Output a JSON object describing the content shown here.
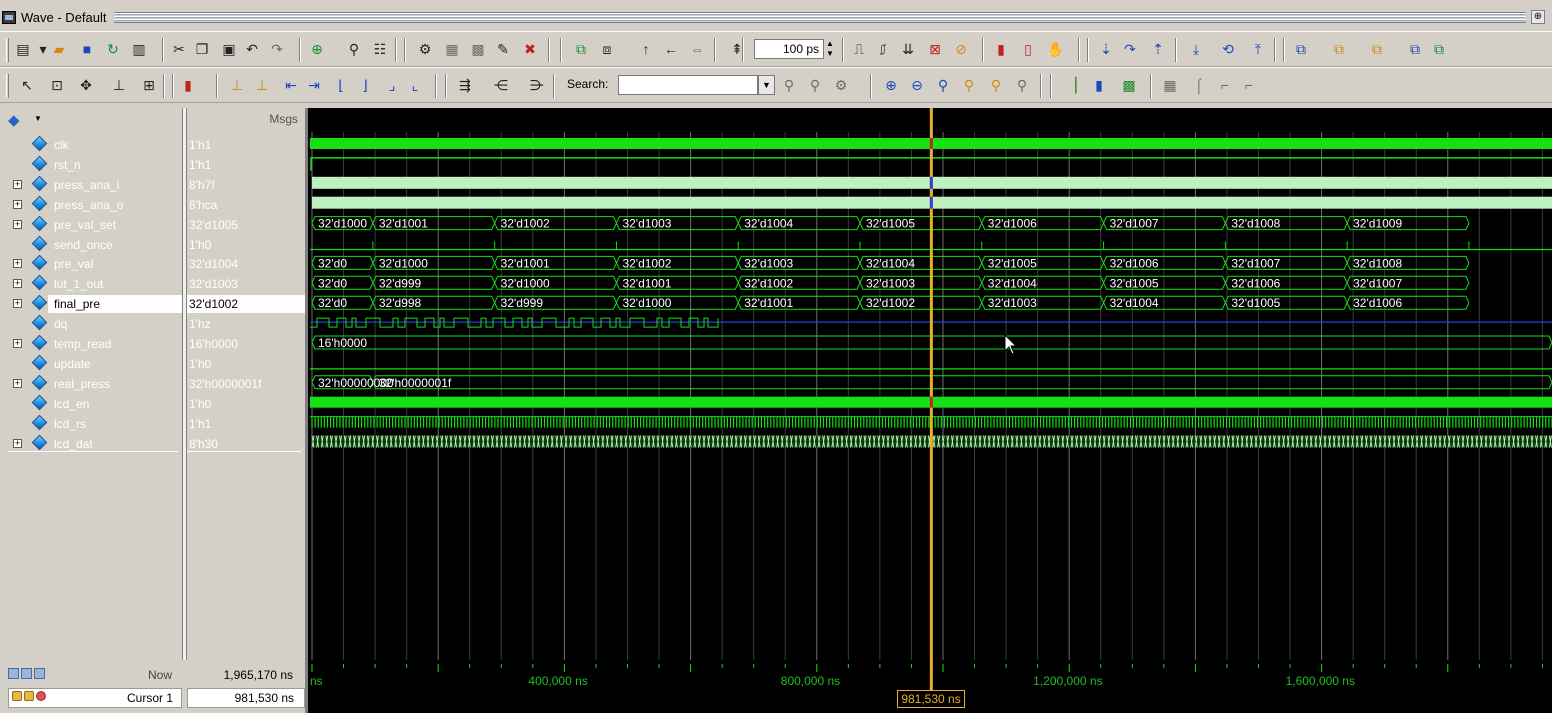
{
  "window": {
    "title": "Wave - Default",
    "restore_glyph": "⊕"
  },
  "toolbar1": {
    "buttons": [
      {
        "name": "print-icon",
        "glyph": "▤",
        "color": "#222"
      },
      {
        "name": "dropdown-icon",
        "glyph": "▾",
        "color": "#222"
      },
      {
        "name": "open-folder-icon",
        "glyph": "▰",
        "color": "#d08a10"
      },
      {
        "name": "save-icon",
        "glyph": "■",
        "color": "#1a46c0"
      },
      {
        "name": "reload-icon",
        "glyph": "↻",
        "color": "#1a8a2a"
      },
      {
        "name": "printer-icon",
        "glyph": "▥",
        "color": "#222"
      },
      {
        "name": "cut-icon",
        "glyph": "✂",
        "color": "#222"
      },
      {
        "name": "copy-icon",
        "glyph": "❐",
        "color": "#222"
      },
      {
        "name": "paste-icon",
        "glyph": "▣",
        "color": "#222"
      },
      {
        "name": "undo-icon",
        "glyph": "↶",
        "color": "#222"
      },
      {
        "name": "redo-icon",
        "glyph": "↷",
        "color": "#6a6a6a"
      },
      {
        "name": "add-icon",
        "glyph": "⊕",
        "color": "#1a8a2a"
      },
      {
        "name": "find-icon",
        "glyph": "⚲",
        "color": "#222"
      },
      {
        "name": "format-icon",
        "glyph": "☷",
        "color": "#222"
      },
      {
        "name": "compile-icon",
        "glyph": "⚙",
        "color": "#222"
      },
      {
        "name": "compile-all-icon",
        "glyph": "▦",
        "color": "#6a6a6a"
      },
      {
        "name": "simulate-icon",
        "glyph": "▩",
        "color": "#6a6a6a"
      },
      {
        "name": "break-icon",
        "glyph": "✎",
        "color": "#222"
      },
      {
        "name": "stop-icon",
        "glyph": "✖",
        "color": "#c0241a"
      },
      {
        "name": "zoom-region-icon",
        "glyph": "⧉",
        "color": "#1a8a2a"
      },
      {
        "name": "insert-icon",
        "glyph": "⧈",
        "color": "#222"
      },
      {
        "name": "up-arrow-icon",
        "glyph": "↑",
        "color": "#222"
      },
      {
        "name": "left-arrow-icon",
        "glyph": "←",
        "color": "#222"
      },
      {
        "name": "swap-icon",
        "glyph": "⇔",
        "color": "#6a6a6a"
      },
      {
        "name": "run-length-icon",
        "glyph": "⇞",
        "color": "#222"
      },
      {
        "name": "run-icon",
        "glyph": "⎍",
        "color": "#222"
      },
      {
        "name": "continue-icon",
        "glyph": "⎎",
        "color": "#222"
      },
      {
        "name": "run-all-icon",
        "glyph": "⇊",
        "color": "#222"
      },
      {
        "name": "break-sim-icon",
        "glyph": "⊠",
        "color": "#c0241a"
      },
      {
        "name": "stop-sim-icon",
        "glyph": "⊘",
        "color": "#d08a10"
      },
      {
        "name": "performance-icon",
        "glyph": "▮",
        "color": "#c0241a"
      },
      {
        "name": "memory-icon",
        "glyph": "▯",
        "color": "#c0241a"
      },
      {
        "name": "hand-icon",
        "glyph": "✋",
        "color": "#222"
      },
      {
        "name": "step-icon",
        "glyph": "⇣",
        "color": "#1a46c0"
      },
      {
        "name": "step-over-icon",
        "glyph": "↷",
        "color": "#1a46c0"
      },
      {
        "name": "step-out-icon",
        "glyph": "⇡",
        "color": "#1a46c0"
      },
      {
        "name": "step-into-icon",
        "glyph": "⤓",
        "color": "#1a46c0"
      },
      {
        "name": "step-back-icon",
        "glyph": "⟲",
        "color": "#1a46c0"
      },
      {
        "name": "step-up-icon",
        "glyph": "⤒",
        "color": "#1a46c0"
      },
      {
        "name": "layout-icon-1",
        "glyph": "⧉",
        "color": "#1a46c0"
      },
      {
        "name": "layout-icon-2",
        "glyph": "⧉",
        "color": "#d08a10"
      },
      {
        "name": "layout-icon-3",
        "glyph": "⧉",
        "color": "#d08a10"
      },
      {
        "name": "layout-icon-4",
        "glyph": "⧉",
        "color": "#1a46c0"
      },
      {
        "name": "layout-icon-5",
        "glyph": "⧉",
        "color": "#1a8a2a"
      }
    ],
    "run_length": "100 ps"
  },
  "toolbar2": {
    "buttons": [
      {
        "name": "select-icon",
        "glyph": "↖",
        "color": "#222"
      },
      {
        "name": "zoom-mode-icon",
        "glyph": "⊡",
        "color": "#222"
      },
      {
        "name": "pan-icon",
        "glyph": "✥",
        "color": "#222"
      },
      {
        "name": "insert-cursor-icon",
        "glyph": "⊥",
        "color": "#222"
      },
      {
        "name": "edit-mode-icon",
        "glyph": "⊞",
        "color": "#222"
      },
      {
        "name": "stop-light-icon",
        "glyph": "▮",
        "color": "#c0241a"
      },
      {
        "name": "edge-rise-icon",
        "glyph": "⊥",
        "color": "#d08a10"
      },
      {
        "name": "edge-fall-icon",
        "glyph": "⊥",
        "color": "#d08a10"
      },
      {
        "name": "edge-prev-icon",
        "glyph": "⇤",
        "color": "#1a46c0"
      },
      {
        "name": "edge-next-icon",
        "glyph": "⇥",
        "color": "#1a46c0"
      },
      {
        "name": "prev-transition-icon",
        "glyph": "⌊",
        "color": "#1a46c0"
      },
      {
        "name": "next-transition-icon",
        "glyph": "⌋",
        "color": "#1a46c0"
      },
      {
        "name": "falling-icon",
        "glyph": "⌟",
        "color": "#1a46c0"
      },
      {
        "name": "rising-icon",
        "glyph": "⌞",
        "color": "#1a46c0"
      },
      {
        "name": "expand-icon",
        "glyph": "⇶",
        "color": "#222"
      },
      {
        "name": "collapse-icon",
        "glyph": "⋲",
        "color": "#222"
      },
      {
        "name": "combine-icon",
        "glyph": "⋺",
        "color": "#222"
      },
      {
        "name": "search-find-icon",
        "glyph": "⚲",
        "color": "#6a6a6a"
      },
      {
        "name": "search-prev-icon",
        "glyph": "⚲",
        "color": "#6a6a6a"
      },
      {
        "name": "search-options-icon",
        "glyph": "⚙",
        "color": "#6a6a6a"
      },
      {
        "name": "zoom-in-icon",
        "glyph": "⊕",
        "color": "#1a46c0"
      },
      {
        "name": "zoom-out-icon",
        "glyph": "⊖",
        "color": "#1a46c0"
      },
      {
        "name": "zoom-full-icon",
        "glyph": "⚲",
        "color": "#1a46c0"
      },
      {
        "name": "zoom-cursor-icon",
        "glyph": "⚲",
        "color": "#d08a10"
      },
      {
        "name": "zoom-last-icon",
        "glyph": "⚲",
        "color": "#d08a10"
      },
      {
        "name": "zoom-region2-icon",
        "glyph": "⚲",
        "color": "#6a6a6a"
      },
      {
        "name": "wave-bar-icon",
        "glyph": "▕",
        "color": "#1a8a2a"
      },
      {
        "name": "wave-fill-icon",
        "glyph": "▮",
        "color": "#1a46c0"
      },
      {
        "name": "wave-dense-icon",
        "glyph": "▩",
        "color": "#1a8a2a"
      },
      {
        "name": "grid-icon",
        "glyph": "▦",
        "color": "#6a6a6a"
      },
      {
        "name": "signal-style1-icon",
        "glyph": "⌠",
        "color": "#6a6a6a"
      },
      {
        "name": "signal-style2-icon",
        "glyph": "⌐",
        "color": "#6a6a6a"
      },
      {
        "name": "signal-style3-icon",
        "glyph": "⌐",
        "color": "#6a6a6a"
      }
    ],
    "search_label": "Search:",
    "search_value": ""
  },
  "signals_header": {
    "msgs_label": "Msgs"
  },
  "signals": [
    {
      "name": "clk",
      "value": "1'h1",
      "expandable": false
    },
    {
      "name": "rst_n",
      "value": "1'h1",
      "expandable": false
    },
    {
      "name": "press_ana_i",
      "value": "8'h7f",
      "expandable": true
    },
    {
      "name": "press_ana_o",
      "value": "8'hca",
      "expandable": true
    },
    {
      "name": "pre_val_set",
      "value": "32'd1005",
      "expandable": true
    },
    {
      "name": "send_once",
      "value": "1'h0",
      "expandable": false
    },
    {
      "name": "pre_val",
      "value": "32'd1004",
      "expandable": true
    },
    {
      "name": "lut_1_out",
      "value": "32'd1003",
      "expandable": true
    },
    {
      "name": "final_pre",
      "value": "32'd1002",
      "expandable": true,
      "selected": true
    },
    {
      "name": "dq",
      "value": "1'hz",
      "expandable": false
    },
    {
      "name": "temp_read",
      "value": "16'h0000",
      "expandable": true
    },
    {
      "name": "update",
      "value": "1'h0",
      "expandable": false
    },
    {
      "name": "real_press",
      "value": "32'h0000001f",
      "expandable": true
    },
    {
      "name": "lcd_en",
      "value": "1'h0",
      "expandable": false
    },
    {
      "name": "lcd_rs",
      "value": "1'h1",
      "expandable": false
    },
    {
      "name": "lcd_dat",
      "value": "8'h30",
      "expandable": true
    }
  ],
  "waves": {
    "pre_val_set": [
      "32'd1000",
      "32'd1001",
      "32'd1002",
      "32'd1003",
      "32'd1004",
      "32'd1005",
      "32'd1006",
      "32'd1007",
      "32'd1008",
      "32'd1009"
    ],
    "pre_val": [
      "32'd0",
      "32'd1000",
      "32'd1001",
      "32'd1002",
      "32'd1003",
      "32'd1004",
      "32'd1005",
      "32'd1006",
      "32'd1007",
      "32'd1008"
    ],
    "lut_1_out": [
      "32'd0",
      "32'd999",
      "32'd1000",
      "32'd1001",
      "32'd1002",
      "32'd1003",
      "32'd1004",
      "32'd1005",
      "32'd1006",
      "32'd1007"
    ],
    "final_pre": [
      "32'd0",
      "32'd998",
      "32'd999",
      "32'd1000",
      "32'd1001",
      "32'd1002",
      "32'd1003",
      "32'd1004",
      "32'd1005",
      "32'd1006"
    ],
    "temp_read": [
      "16'h0000"
    ],
    "real_press": [
      "32'h00000000",
      "32'h0000001f"
    ],
    "sim_end_ns": 1965170,
    "cursor_ns": 981530,
    "bus_step_ns": 193000,
    "colors": {
      "background": "#000000",
      "signal": "#14e014",
      "analog_fill": "#bff0bf",
      "grid": "#5a5a5a",
      "cursor": "#e7b02a",
      "cursor_marker": "#c0241a",
      "dq_line": "#2040e0"
    }
  },
  "status": {
    "now_label": "Now",
    "now_value": "1,965,170 ns",
    "cursor_label": "Cursor 1",
    "cursor_value": "981,530 ns"
  },
  "timeline": {
    "start_label": "ns",
    "ticks": [
      {
        "ns": 400000,
        "label": "400,000 ns"
      },
      {
        "ns": 800000,
        "label": "800,000 ns"
      },
      {
        "ns": 1200000,
        "label": "1,200,000 ns"
      },
      {
        "ns": 1600000,
        "label": "1,600,000 ns"
      }
    ],
    "cursor_badge": "981,530 ns"
  }
}
